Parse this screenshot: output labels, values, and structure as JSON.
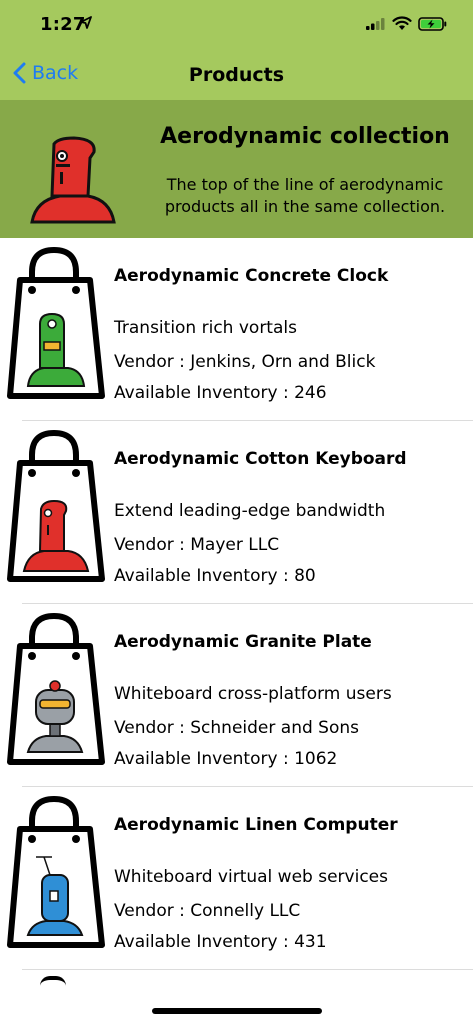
{
  "status": {
    "time": "1:27"
  },
  "nav": {
    "back_label": "Back",
    "title": "Products"
  },
  "collection": {
    "title": "Aerodynamic collection",
    "description": "The top of the line of aerodynamic products all in the same collection."
  },
  "products": [
    {
      "name": "Aerodynamic Concrete Clock",
      "description": "Transition rich vortals",
      "vendor": "Vendor : Jenkins, Orn and Blick",
      "inventory": "Available Inventory : 246",
      "robot_color": "#3cab3a"
    },
    {
      "name": "Aerodynamic Cotton Keyboard",
      "description": "Extend leading-edge bandwidth",
      "vendor": "Vendor : Mayer LLC",
      "inventory": "Available Inventory : 80",
      "robot_color": "#e0302b"
    },
    {
      "name": "Aerodynamic Granite Plate",
      "description": "Whiteboard cross-platform users",
      "vendor": "Vendor : Schneider and Sons",
      "inventory": "Available Inventory : 1062",
      "robot_color": "#9aa0a6"
    },
    {
      "name": "Aerodynamic Linen Computer",
      "description": "Whiteboard virtual web services",
      "vendor": "Vendor : Connelly LLC",
      "inventory": "Available Inventory : 431",
      "robot_color": "#2f8fd6"
    }
  ]
}
